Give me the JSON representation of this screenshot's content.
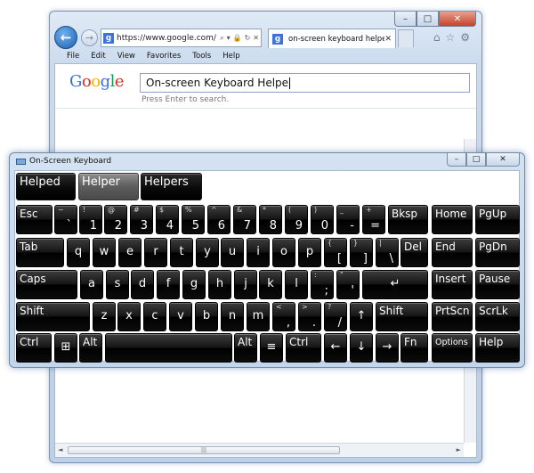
{
  "browser": {
    "caption_buttons": [
      "–",
      "□",
      "✕"
    ],
    "back_glyph": "←",
    "forward_glyph": "→",
    "address": {
      "favicon": "g",
      "url": "https://www.google.com/",
      "icons": [
        "⌕",
        "▾",
        "🔒",
        "↻",
        "✕"
      ]
    },
    "tab": {
      "favicon": "g",
      "label": "on-screen keyboard helper ...",
      "close": "✕"
    },
    "toolbar_icons": [
      "⌂",
      "☆",
      "⚙"
    ],
    "menu": [
      "File",
      "Edit",
      "View",
      "Favorites",
      "Tools",
      "Help"
    ],
    "google_logo": [
      {
        "ch": "G",
        "color": "#3b6fd8"
      },
      {
        "ch": "o",
        "color": "#d62d20"
      },
      {
        "ch": "o",
        "color": "#f4b400"
      },
      {
        "ch": "g",
        "color": "#3b6fd8"
      },
      {
        "ch": "l",
        "color": "#109d58"
      },
      {
        "ch": "e",
        "color": "#d62d20"
      }
    ],
    "search_value": "On-screen Keyboard  Helpe",
    "search_hint": "Press Enter to search.",
    "hscroll_grip": "|||",
    "hscroll_left": "◄",
    "hscroll_right": "►"
  },
  "osk": {
    "title": "On-Screen Keyboard",
    "caption_buttons": [
      "–",
      "□",
      "✕"
    ],
    "suggestions": [
      {
        "label": "Helped",
        "selected": false
      },
      {
        "label": "Helper",
        "selected": true
      },
      {
        "label": "Helpers",
        "selected": false
      }
    ],
    "rows": [
      [
        {
          "id": "esc",
          "main": "Esc"
        },
        {
          "id": "backtick",
          "top": "~",
          "main": "`",
          "dual": true
        },
        {
          "id": "1",
          "top": "!",
          "main": "1",
          "dual": true
        },
        {
          "id": "2",
          "top": "@",
          "main": "2",
          "dual": true
        },
        {
          "id": "3",
          "top": "#",
          "main": "3",
          "dual": true
        },
        {
          "id": "4",
          "top": "$",
          "main": "4",
          "dual": true
        },
        {
          "id": "5",
          "top": "%",
          "main": "5",
          "dual": true
        },
        {
          "id": "6",
          "top": "^",
          "main": "6",
          "dual": true
        },
        {
          "id": "7",
          "top": "&",
          "main": "7",
          "dual": true
        },
        {
          "id": "8",
          "top": "*",
          "main": "8",
          "dual": true
        },
        {
          "id": "9",
          "top": "(",
          "main": "9",
          "dual": true
        },
        {
          "id": "0",
          "top": ")",
          "main": "0",
          "dual": true
        },
        {
          "id": "minus",
          "top": "_",
          "main": "-",
          "dual": true
        },
        {
          "id": "equals",
          "top": "+",
          "main": "=",
          "dual": true
        },
        {
          "id": "bksp",
          "main": "Bksp"
        },
        {
          "id": "home",
          "main": "Home"
        },
        {
          "id": "pgup",
          "main": "PgUp"
        }
      ],
      [
        {
          "id": "tab",
          "main": "Tab"
        },
        {
          "id": "q",
          "main": "q",
          "center": true
        },
        {
          "id": "w",
          "main": "w",
          "center": true
        },
        {
          "id": "e",
          "main": "e",
          "center": true
        },
        {
          "id": "r",
          "main": "r",
          "center": true
        },
        {
          "id": "t",
          "main": "t",
          "center": true
        },
        {
          "id": "y",
          "main": "y",
          "center": true
        },
        {
          "id": "u",
          "main": "u",
          "center": true
        },
        {
          "id": "i",
          "main": "i",
          "center": true
        },
        {
          "id": "o",
          "main": "o",
          "center": true
        },
        {
          "id": "p",
          "main": "p",
          "center": true
        },
        {
          "id": "lbracket",
          "top": "{",
          "main": "[",
          "dual": true
        },
        {
          "id": "rbracket",
          "top": "}",
          "main": "]",
          "dual": true
        },
        {
          "id": "backslash",
          "top": "|",
          "main": "\\",
          "dual": true
        },
        {
          "id": "del",
          "main": "Del"
        },
        {
          "id": "end",
          "main": "End"
        },
        {
          "id": "pgdn",
          "main": "PgDn"
        }
      ],
      [
        {
          "id": "caps",
          "main": "Caps"
        },
        {
          "id": "a",
          "main": "a",
          "center": true
        },
        {
          "id": "s",
          "main": "s",
          "center": true
        },
        {
          "id": "d",
          "main": "d",
          "center": true
        },
        {
          "id": "f",
          "main": "f",
          "center": true
        },
        {
          "id": "g",
          "main": "g",
          "center": true
        },
        {
          "id": "h",
          "main": "h",
          "center": true
        },
        {
          "id": "j",
          "main": "j",
          "center": true
        },
        {
          "id": "k",
          "main": "k",
          "center": true
        },
        {
          "id": "l",
          "main": "l",
          "center": true
        },
        {
          "id": "semicolon",
          "top": ":",
          "main": ";",
          "dual": true
        },
        {
          "id": "quote",
          "top": "\"",
          "main": "'",
          "dual": true
        },
        {
          "id": "enter",
          "main": "↵",
          "center": true
        },
        {
          "id": "insert",
          "main": "Insert"
        },
        {
          "id": "pause",
          "main": "Pause"
        }
      ],
      [
        {
          "id": "lshift",
          "main": "Shift"
        },
        {
          "id": "z",
          "main": "z",
          "center": true
        },
        {
          "id": "x",
          "main": "x",
          "center": true
        },
        {
          "id": "c",
          "main": "c",
          "center": true
        },
        {
          "id": "v",
          "main": "v",
          "center": true
        },
        {
          "id": "b",
          "main": "b",
          "center": true
        },
        {
          "id": "n",
          "main": "n",
          "center": true
        },
        {
          "id": "m",
          "main": "m",
          "center": true
        },
        {
          "id": "comma",
          "top": "<",
          "main": ",",
          "dual": true
        },
        {
          "id": "period",
          "top": ">",
          "main": ".",
          "dual": true
        },
        {
          "id": "slash",
          "top": "?",
          "main": "/",
          "dual": true
        },
        {
          "id": "up",
          "main": "↑",
          "center": true
        },
        {
          "id": "rshift",
          "main": "Shift"
        },
        {
          "id": "prtscn",
          "main": "PrtScn"
        },
        {
          "id": "scrlk",
          "main": "ScrLk"
        }
      ],
      [
        {
          "id": "lctrl",
          "main": "Ctrl"
        },
        {
          "id": "win",
          "main": "⊞",
          "center": true
        },
        {
          "id": "lalt",
          "main": "Alt"
        },
        {
          "id": "space",
          "main": ""
        },
        {
          "id": "ralt",
          "main": "Alt"
        },
        {
          "id": "menu",
          "main": "≡",
          "center": true
        },
        {
          "id": "rctrl",
          "main": "Ctrl"
        },
        {
          "id": "left",
          "main": "←",
          "center": true
        },
        {
          "id": "down",
          "main": "↓",
          "center": true
        },
        {
          "id": "right",
          "main": "→",
          "center": true
        },
        {
          "id": "fn",
          "main": "Fn"
        },
        {
          "id": "options",
          "main": "Options",
          "small": true
        },
        {
          "id": "help",
          "main": "Help"
        }
      ]
    ]
  }
}
